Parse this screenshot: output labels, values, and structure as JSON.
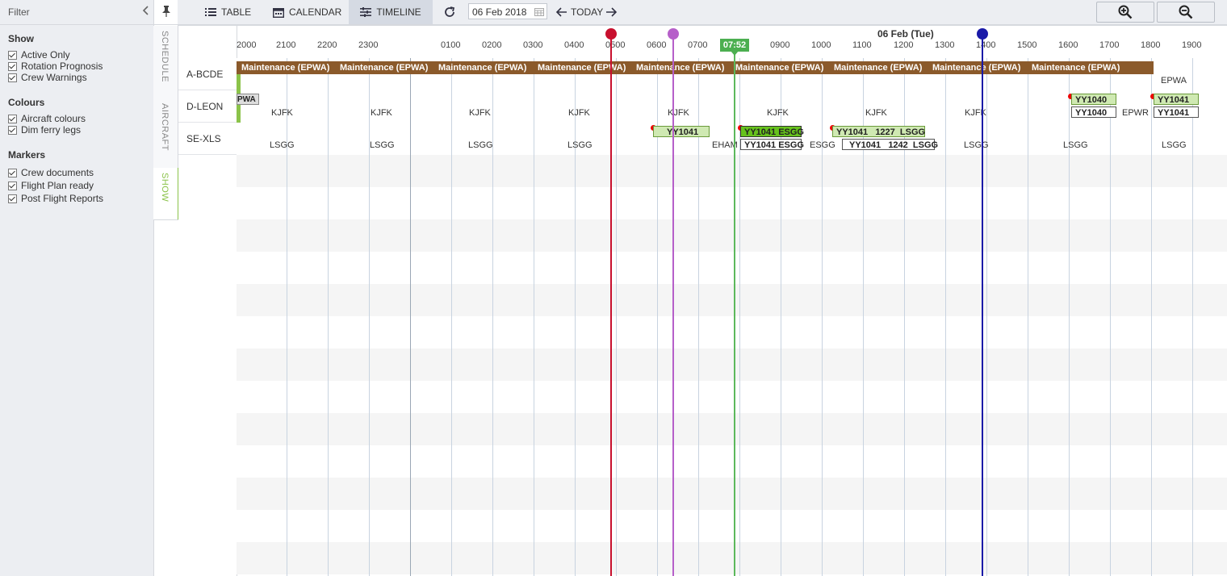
{
  "filter": {
    "title": "Filter",
    "sections": [
      {
        "title": "Show",
        "items": [
          "Active Only",
          "Rotation Prognosis",
          "Crew Warnings"
        ]
      },
      {
        "title": "Colours",
        "items": [
          "Aircraft colours",
          "Dim ferry legs"
        ]
      },
      {
        "title": "Markers",
        "items": [
          "Crew documents",
          "Flight Plan ready",
          "Post Flight Reports"
        ]
      }
    ]
  },
  "vtabs": [
    "SCHEDULE",
    "AIRCRAFT",
    "SHOW"
  ],
  "toolbar": {
    "table": "TABLE",
    "calendar": "CALENDAR",
    "timeline": "TIMELINE",
    "date": "06 Feb 2018",
    "today": "TODAY"
  },
  "timeline": {
    "date_header": "06 Feb (Tue)",
    "now_time": "07:52",
    "hours": [
      "2000",
      "2100",
      "2200",
      "2300",
      "0100",
      "0200",
      "0300",
      "0400",
      "0500",
      "0600",
      "0700",
      "0900",
      "1000",
      "1100",
      "1200",
      "1300",
      "1400",
      "1500",
      "1600",
      "1700",
      "1800",
      "1900"
    ],
    "rows": [
      "A-BCDE",
      "D-LEON",
      "SE-XLS"
    ],
    "maintenance_label": "Maintenance (EPWA)",
    "epwa_partial": "PWA",
    "row1_airports": [
      "EPWA"
    ],
    "row2_airports": [
      "KJFK",
      "KJFK",
      "KJFK",
      "KJFK",
      "KJFK",
      "KJFK",
      "KJFK",
      "KJFK",
      "EPWR"
    ],
    "row3_airports": [
      "LSGG",
      "LSGG",
      "LSGG",
      "LSGG",
      "EHAM",
      "ESGG",
      "LSGG",
      "LSGG",
      "LSGG"
    ],
    "flights": {
      "f1": "YY1041",
      "f2": "YY1041 ESGG",
      "f3": "YY1041 ESGG",
      "f4": "YY1041   1227  LSGG",
      "f5": "YY1041   1242  LSGG",
      "f6": "YY1040",
      "f7": "YY1040",
      "f8": "YY1041",
      "f9": "YY1041"
    }
  },
  "colors": {
    "accent_green": "#8bc34a",
    "maintenance": "#8b5a2b",
    "marker_red": "#c8102e",
    "marker_purple": "#b65fc9",
    "marker_green": "#5cb85c",
    "marker_blue": "#1a1aa8"
  }
}
